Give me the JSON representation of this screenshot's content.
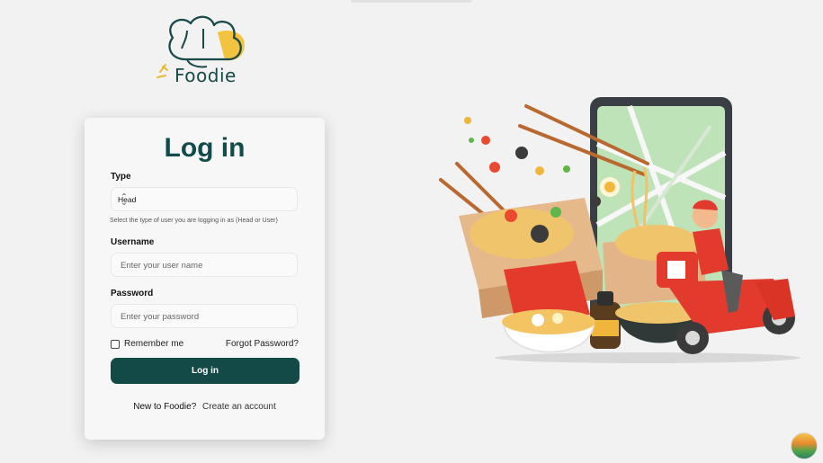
{
  "brand": {
    "name": "Foodie"
  },
  "login": {
    "title": "Log in",
    "type_label": "Type",
    "type_value": "Head",
    "type_help": "Select the type of user you are logging in as (Head or User)",
    "username_label": "Username",
    "username_placeholder": "Enter your user name",
    "password_label": "Password",
    "password_placeholder": "Enter your password",
    "remember_label": "Remember me",
    "forgot_label": "Forgot Password?",
    "submit_label": "Log in",
    "new_prompt": "New to Foodie?",
    "create_link": "Create an account"
  },
  "colors": {
    "primary": "#134a47",
    "accent": "#f4b73a",
    "delivery": "#e23b2e"
  },
  "icons": {
    "logo": "chef-hat-logo",
    "select": "select-arrows-icon",
    "hero": "food-delivery-illustration",
    "avatar": "avatar-icon"
  }
}
